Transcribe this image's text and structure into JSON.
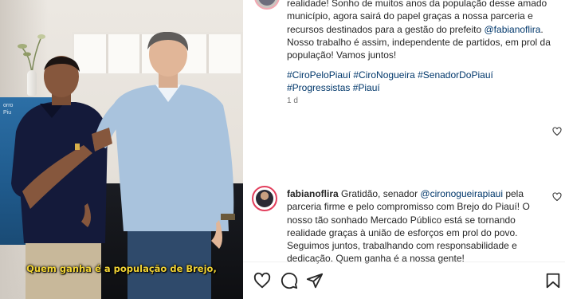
{
  "video": {
    "caption": "Quem ganha é a população de Brejo,",
    "banner_text": "orro\nPiu"
  },
  "post": {
    "text_part1": "realidade! Sonho de muitos anos da população desse amado município, agora sairá do papel graças a nossa parceria e recursos destinados para a gestão do prefeito ",
    "mention": "@fabianoflira",
    "text_part2": ". Nosso trabalho é assim, independente de partidos, em prol da população! Vamos juntos!",
    "hashtags": "#CiroPeloPiauí #CiroNogueira #SenadorDoPiauí #Progressistas #Piauí",
    "time": "1 d"
  },
  "comment": {
    "username": "fabianoflira",
    "text_part1": " Gratidão, senador ",
    "mention": "@cironogueirapiaui",
    "text_part2": " pela parceria firme e pelo compromisso com Brejo do Piauí! O nosso tão sonhado Mercado Público está se tornando realidade graças à união de esforços em prol do povo. Seguimos juntos, trabalhando com responsabilidade e dedicação. Quem ganha é a nossa gente!"
  },
  "icons": {
    "like": "heart-icon",
    "comment": "comment-icon",
    "share": "share-icon",
    "save": "bookmark-icon"
  },
  "colors": {
    "link": "#00376b",
    "caption": "#f3d535",
    "meta": "#737373"
  }
}
